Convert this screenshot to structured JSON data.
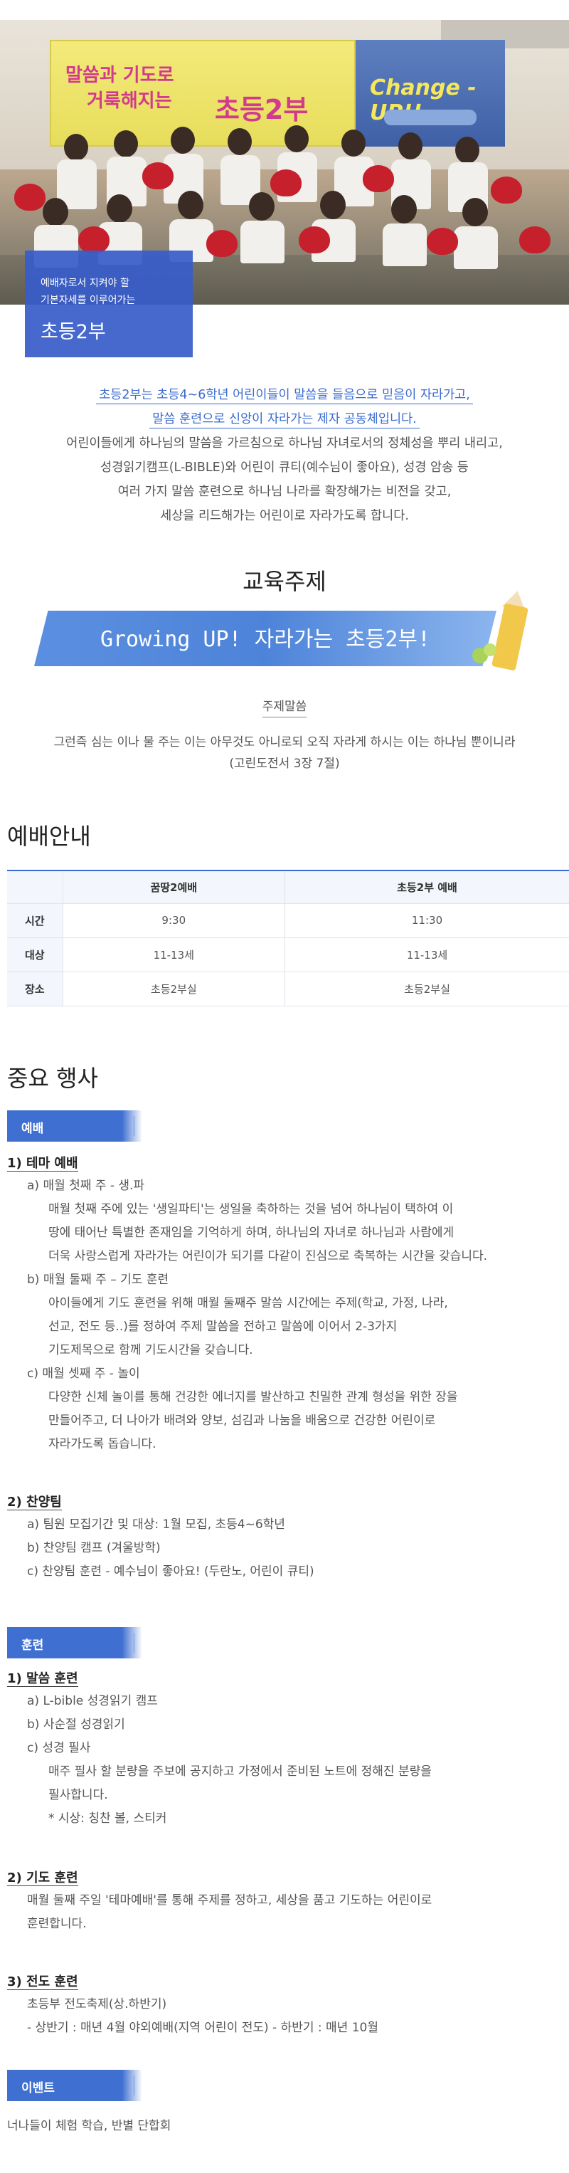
{
  "hero": {
    "banner_left_line1": "말씀과 기도로",
    "banner_left_line2": "거룩해지는",
    "banner_left_big": "초등2부",
    "banner_right_text": "Change - UP!!",
    "card_sub_line1": "예배자로서 지켜야 할",
    "card_sub_line2": "기본자세를 이루어가는",
    "card_title": "초등2부"
  },
  "intro": {
    "highlight_1": "초등2부는 초등4~6학년 어린이들이 말씀을 들음으로 믿음이 자라가고,",
    "highlight_2": "말씀 훈련으로 신앙이 자라가는 제자 공동체입니다.",
    "body": [
      "어린이들에게 하나님의 말씀을 가르침으로 하나님 자녀로서의 정체성을 뿌리 내리고,",
      "성경읽기캠프(L-BIBLE)와 어린이 큐티(예수님이 좋아요), 성경 암송 등",
      "여러 가지 말씀 훈련으로 하나님 나라를 확장해가는 비전을 갖고,",
      "세상을 리드해가는 어린이로 자라가도록 합니다."
    ]
  },
  "education": {
    "title": "교육주제",
    "theme": "Growing UP! 자라가는 초등2부!",
    "verse_label": "주제말씀",
    "verse": "그런즉 심는 이나 물 주는 이는 아무것도 아니로되 오직 자라게 하시는 이는 하나님 뿐이니라",
    "verse_ref": "(고린도전서 3장 7절)"
  },
  "worship": {
    "title": "예배안내",
    "columns": [
      "꿈땅2예배",
      "초등2부  예배"
    ],
    "rows": [
      {
        "label": "시간",
        "values": [
          "9:30",
          "11:30"
        ]
      },
      {
        "label": "대상",
        "values": [
          "11-13세",
          "11-13세"
        ]
      },
      {
        "label": "장소",
        "values": [
          "초등2부실",
          "초등2부실"
        ]
      }
    ]
  },
  "events": {
    "title": "중요 행사",
    "tab_worship": "예배",
    "theme_worship": "1) 테마 예배",
    "a_title": "a) 매월 첫째 주 - 생.파",
    "a_body": [
      "매월 첫째 주에 있는 '생일파티'는 생일을 축하하는 것을 넘어 하나님이 택하여 이",
      "땅에 태어난 특별한 존재임을 기억하게 하며, 하나님의 자녀로 하나님과 사람에게",
      "더욱 사랑스럽게 자라가는 어린이가 되기를 다같이 진심으로 축복하는 시간을 갖습니다."
    ],
    "b_title": "b) 매월 둘째 주 – 기도 훈련",
    "b_body": [
      "아이들에게 기도 훈련을 위해 매월 둘째주 말씀 시간에는 주제(학교, 가정, 나라,",
      "선교, 전도 등..)를 정하여 주제 말씀을   전하고 말씀에 이어서 2-3가지",
      "기도제목으로 함께 기도시간을 갖습니다."
    ],
    "c_title": "c) 매월 셋째 주 - 놀이",
    "c_body": [
      "다양한 신체 놀이를 통해 건강한 에너지를 발산하고 친밀한 관계 형성을 위한 장을",
      "만들어주고, 더 나아가 배려와 양보, 섬김과 나눔을 배움으로 건강한 어린이로",
      "자라가도록 돕습니다."
    ],
    "choir_title": "2) 찬양팀",
    "choir_items": [
      "a) 팀원 모집기간 및 대상: 1월 모집, 초등4~6학년",
      "b) 찬양팀 캠프 (겨울방학)",
      "c) 찬양팀 훈련 - 예수님이 좋아요! (두란노, 어린이 큐티)"
    ],
    "tab_training": "훈련",
    "word_title": "1) 말씀 훈련",
    "word_items": [
      "a) L-bible 성경읽기 캠프",
      "b) 사순절 성경읽기",
      "c) 성경 필사"
    ],
    "word_c_body": [
      "매주 필사 할 분량을 주보에 공지하고 가정에서 준비된 노트에 정해진 분량을",
      "필사합니다.",
      "* 시상: 칭찬 볼, 스티커"
    ],
    "prayer_title": "2) 기도 훈련",
    "prayer_body": [
      "매월 둘째 주일 '테마예배'를 통해 주제를 정하고, 세상을 품고 기도하는 어린이로",
      "훈련합니다."
    ],
    "evangelism_title": "3) 전도 훈련",
    "evangelism_body": [
      "초등부 전도축제(상.하반기)",
      "- 상반기 : 매년 4월 야외예배(지역 어린이 전도) - 하반기 : 매년 10월"
    ],
    "tab_event": "이벤트",
    "event_body": "너나들이 체험 학습, 반별 단합회"
  }
}
